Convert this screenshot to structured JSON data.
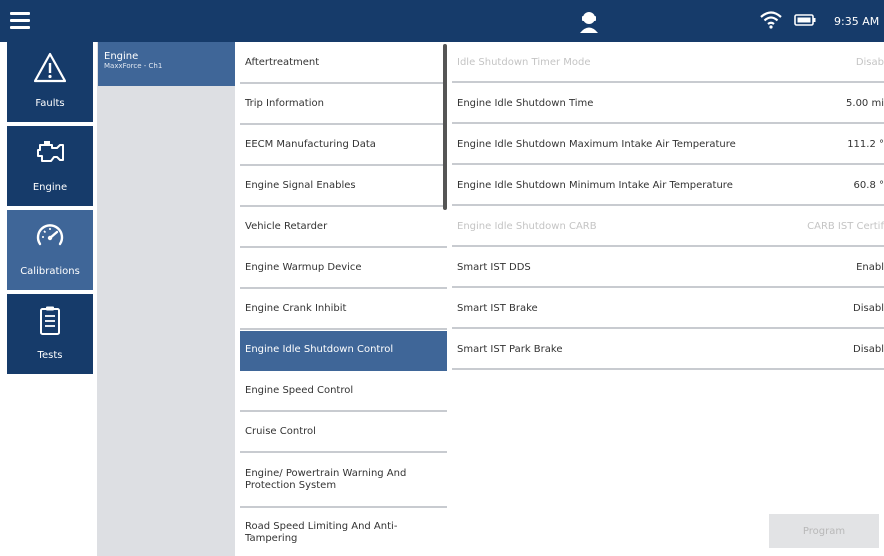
{
  "topbar": {
    "time": "9:35 AM",
    "icons": [
      "menu-icon",
      "agent-icon",
      "wifi-icon",
      "battery-icon"
    ],
    "color": "#163b6a"
  },
  "nav": {
    "items": [
      {
        "label": "Faults",
        "icon": "warning-icon"
      },
      {
        "label": "Engine",
        "icon": "engine-icon"
      },
      {
        "label": "Calibrations",
        "icon": "gauge-icon",
        "active": true
      },
      {
        "label": "Tests",
        "icon": "clipboard-icon"
      }
    ],
    "active_color": "#3f6698"
  },
  "module": {
    "name": "Engine",
    "subtitle": "MaxxForce - Ch1"
  },
  "categories": [
    "Aftertreatment",
    "Trip Information",
    "EECM Manufacturing Data",
    "Engine Signal Enables",
    "Vehicle Retarder",
    "Engine Warmup Device",
    "Engine Crank Inhibit",
    "Engine Idle Shutdown Control",
    "Engine Speed Control",
    "Cruise Control",
    "Engine/ Powertrain Warning And Protection System",
    "Road Speed Limiting And Anti-Tampering"
  ],
  "selected_category": "Engine Idle Shutdown Control",
  "parameters": [
    {
      "name": "Idle Shutdown Timer Mode",
      "value": "Disab",
      "disabled": true
    },
    {
      "name": "Engine Idle Shutdown Time",
      "value": "5.00 mi",
      "disabled": false
    },
    {
      "name": "Engine Idle Shutdown Maximum Intake Air Temperature",
      "value": "111.2 °",
      "disabled": false
    },
    {
      "name": "Engine Idle Shutdown Minimum Intake Air Temperature",
      "value": "60.8 °",
      "disabled": false
    },
    {
      "name": "Engine Idle Shutdown CARB",
      "value": "CARB IST Certif",
      "disabled": true
    },
    {
      "name": "Smart IST DDS",
      "value": "Enabl",
      "disabled": false
    },
    {
      "name": "Smart IST Brake",
      "value": "Disabl",
      "disabled": false
    },
    {
      "name": "Smart IST Park Brake",
      "value": "Disabl",
      "disabled": false
    }
  ],
  "program_label": "Program"
}
